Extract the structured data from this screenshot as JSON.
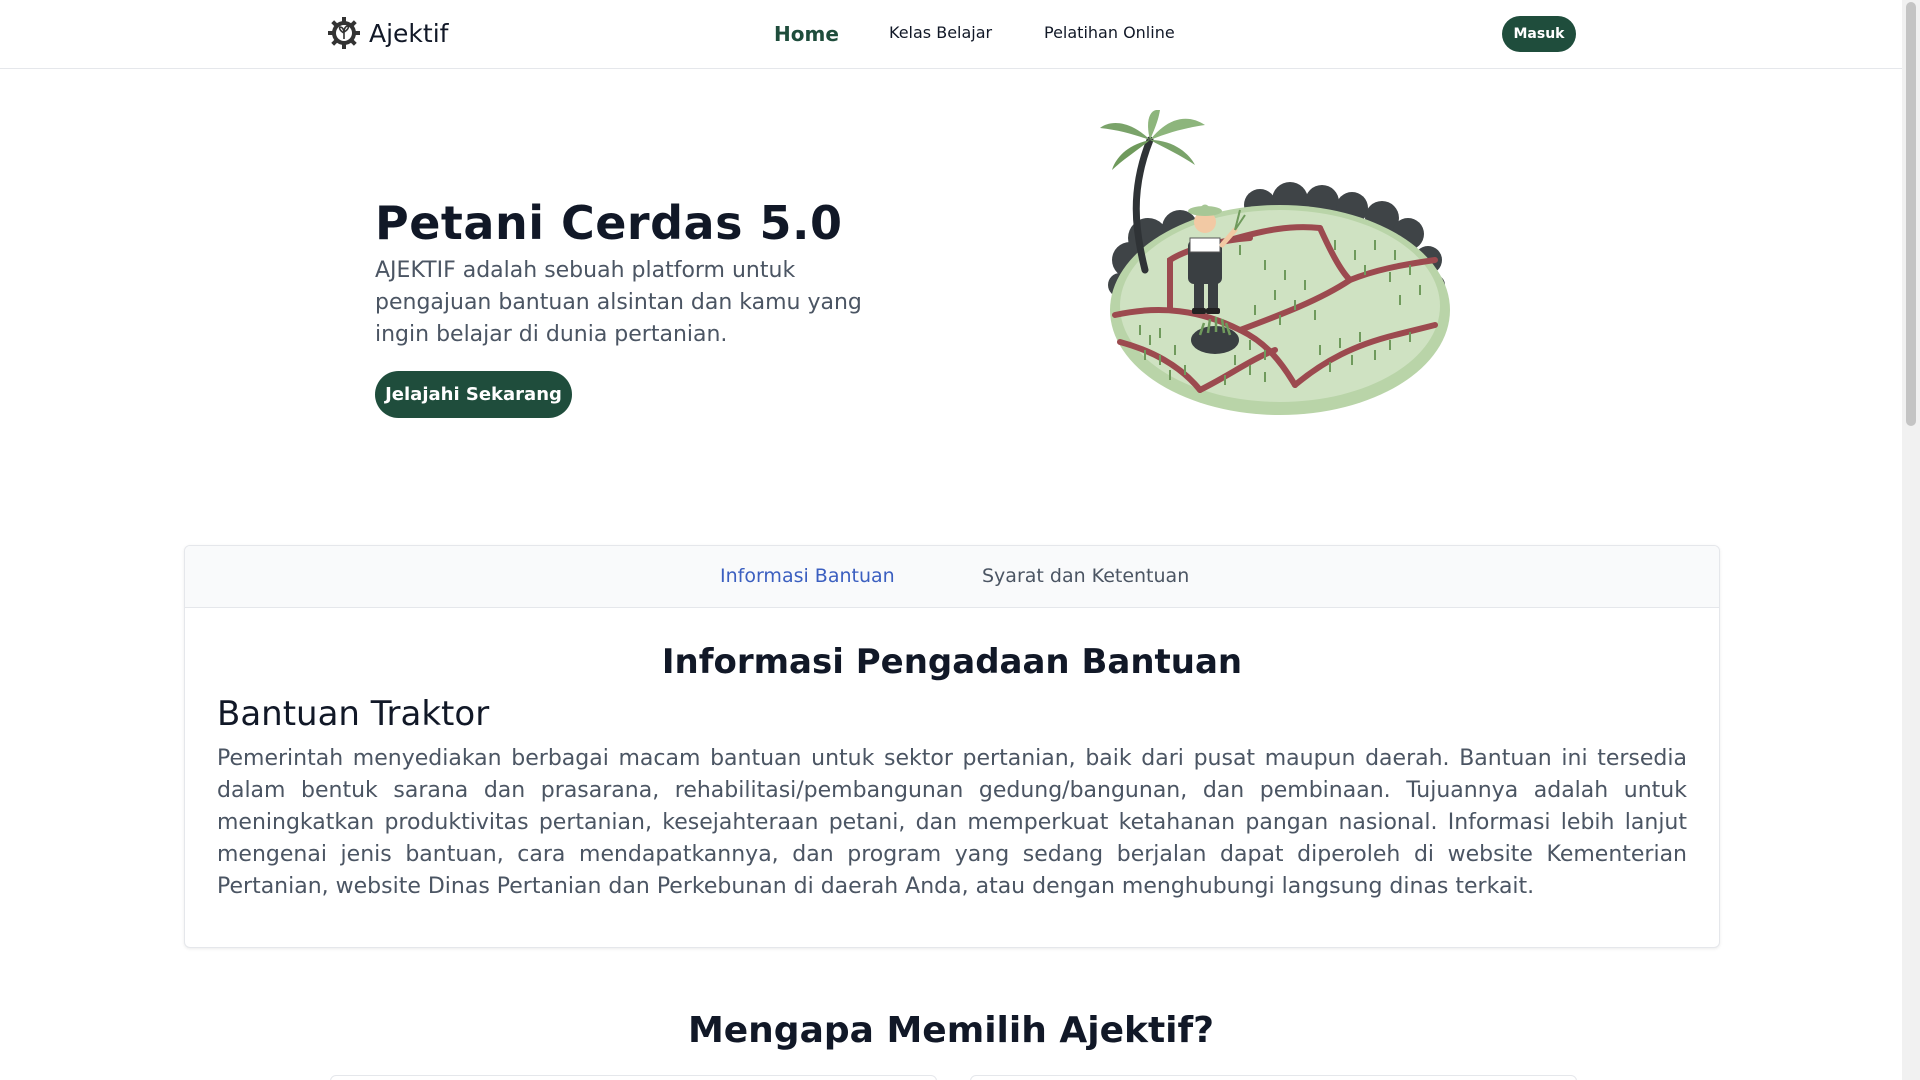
{
  "navbar": {
    "brand": "Ajektif",
    "links": [
      {
        "label": "Home",
        "active": true
      },
      {
        "label": "Kelas Belajar",
        "active": false
      },
      {
        "label": "Pelatihan Online",
        "active": false
      }
    ],
    "login_label": "Masuk"
  },
  "hero": {
    "title": "Petani Cerdas 5.0",
    "description": "AJEKTIF adalah sebuah platform untuk pengajuan bantuan alsintan dan kamu yang ingin belajar di dunia pertanian.",
    "cta_label": "Jelajahi Sekarang"
  },
  "tabs": {
    "items": [
      {
        "label": "Informasi Bantuan",
        "active": true
      },
      {
        "label": "Syarat dan Ketentuan",
        "active": false
      }
    ],
    "panel": {
      "title": "Informasi Pengadaan Bantuan",
      "subtitle": "Bantuan Traktor",
      "body": "Pemerintah menyediakan berbagai macam bantuan untuk sektor pertanian, baik dari pusat maupun daerah. Bantuan ini tersedia dalam bentuk sarana dan prasarana, rehabilitasi/pembangunan gedung/bangunan, dan pembinaan. Tujuannya adalah untuk meningkatkan produktivitas pertanian, kesejahteraan petani, dan memperkuat ketahanan pangan nasional. Informasi lebih lanjut mengenai jenis bantuan, cara mendapatkannya, dan program yang sedang berjalan dapat diperoleh di website Kementerian Pertanian, website Dinas Pertanian dan Perkebunan di daerah Anda, atau dengan menghubungi langsung dinas terkait."
    }
  },
  "why": {
    "title": "Mengapa Memilih Ajektif?"
  },
  "colors": {
    "primary": "#1f4d3c",
    "tab_active": "#3b5fc0",
    "text_muted": "#4b5563"
  },
  "icons": {
    "brand": "gear-leaf-icon"
  }
}
